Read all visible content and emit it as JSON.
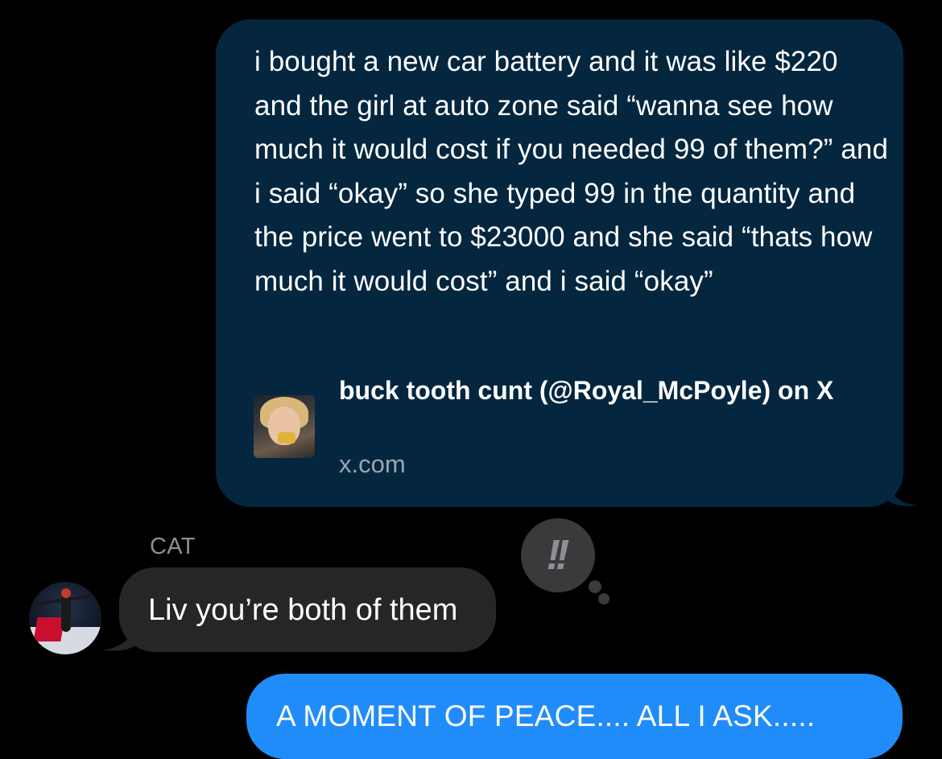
{
  "thread": {
    "link_message": {
      "text": "i bought a new car battery and it was like $220 and the girl at auto zone said “wanna see how much it would cost if you needed 99 of them?” and i said “okay” so she typed 99 in the quantity and the price went to $23000 and she said “thats how much it would cost” and i said “okay”",
      "preview_title": "buck tooth cunt (@Royal_McPoyle) on X",
      "preview_domain": "x.com"
    },
    "received_message": {
      "sender": "CAT",
      "text": "Liv you’re both of them",
      "reaction": "!!"
    },
    "sent_message": {
      "text": "A MOMENT OF PEACE.... ALL I ASK....."
    }
  },
  "colors": {
    "background": "#000000",
    "link_bubble": "#04263f",
    "received_bubble": "#262628",
    "sent_bubble": "#208cf9",
    "tapback_bubble": "#3a3a3c",
    "secondary_text": "#8d8d93"
  },
  "icons": {
    "reaction": "double-exclamation-icon"
  }
}
